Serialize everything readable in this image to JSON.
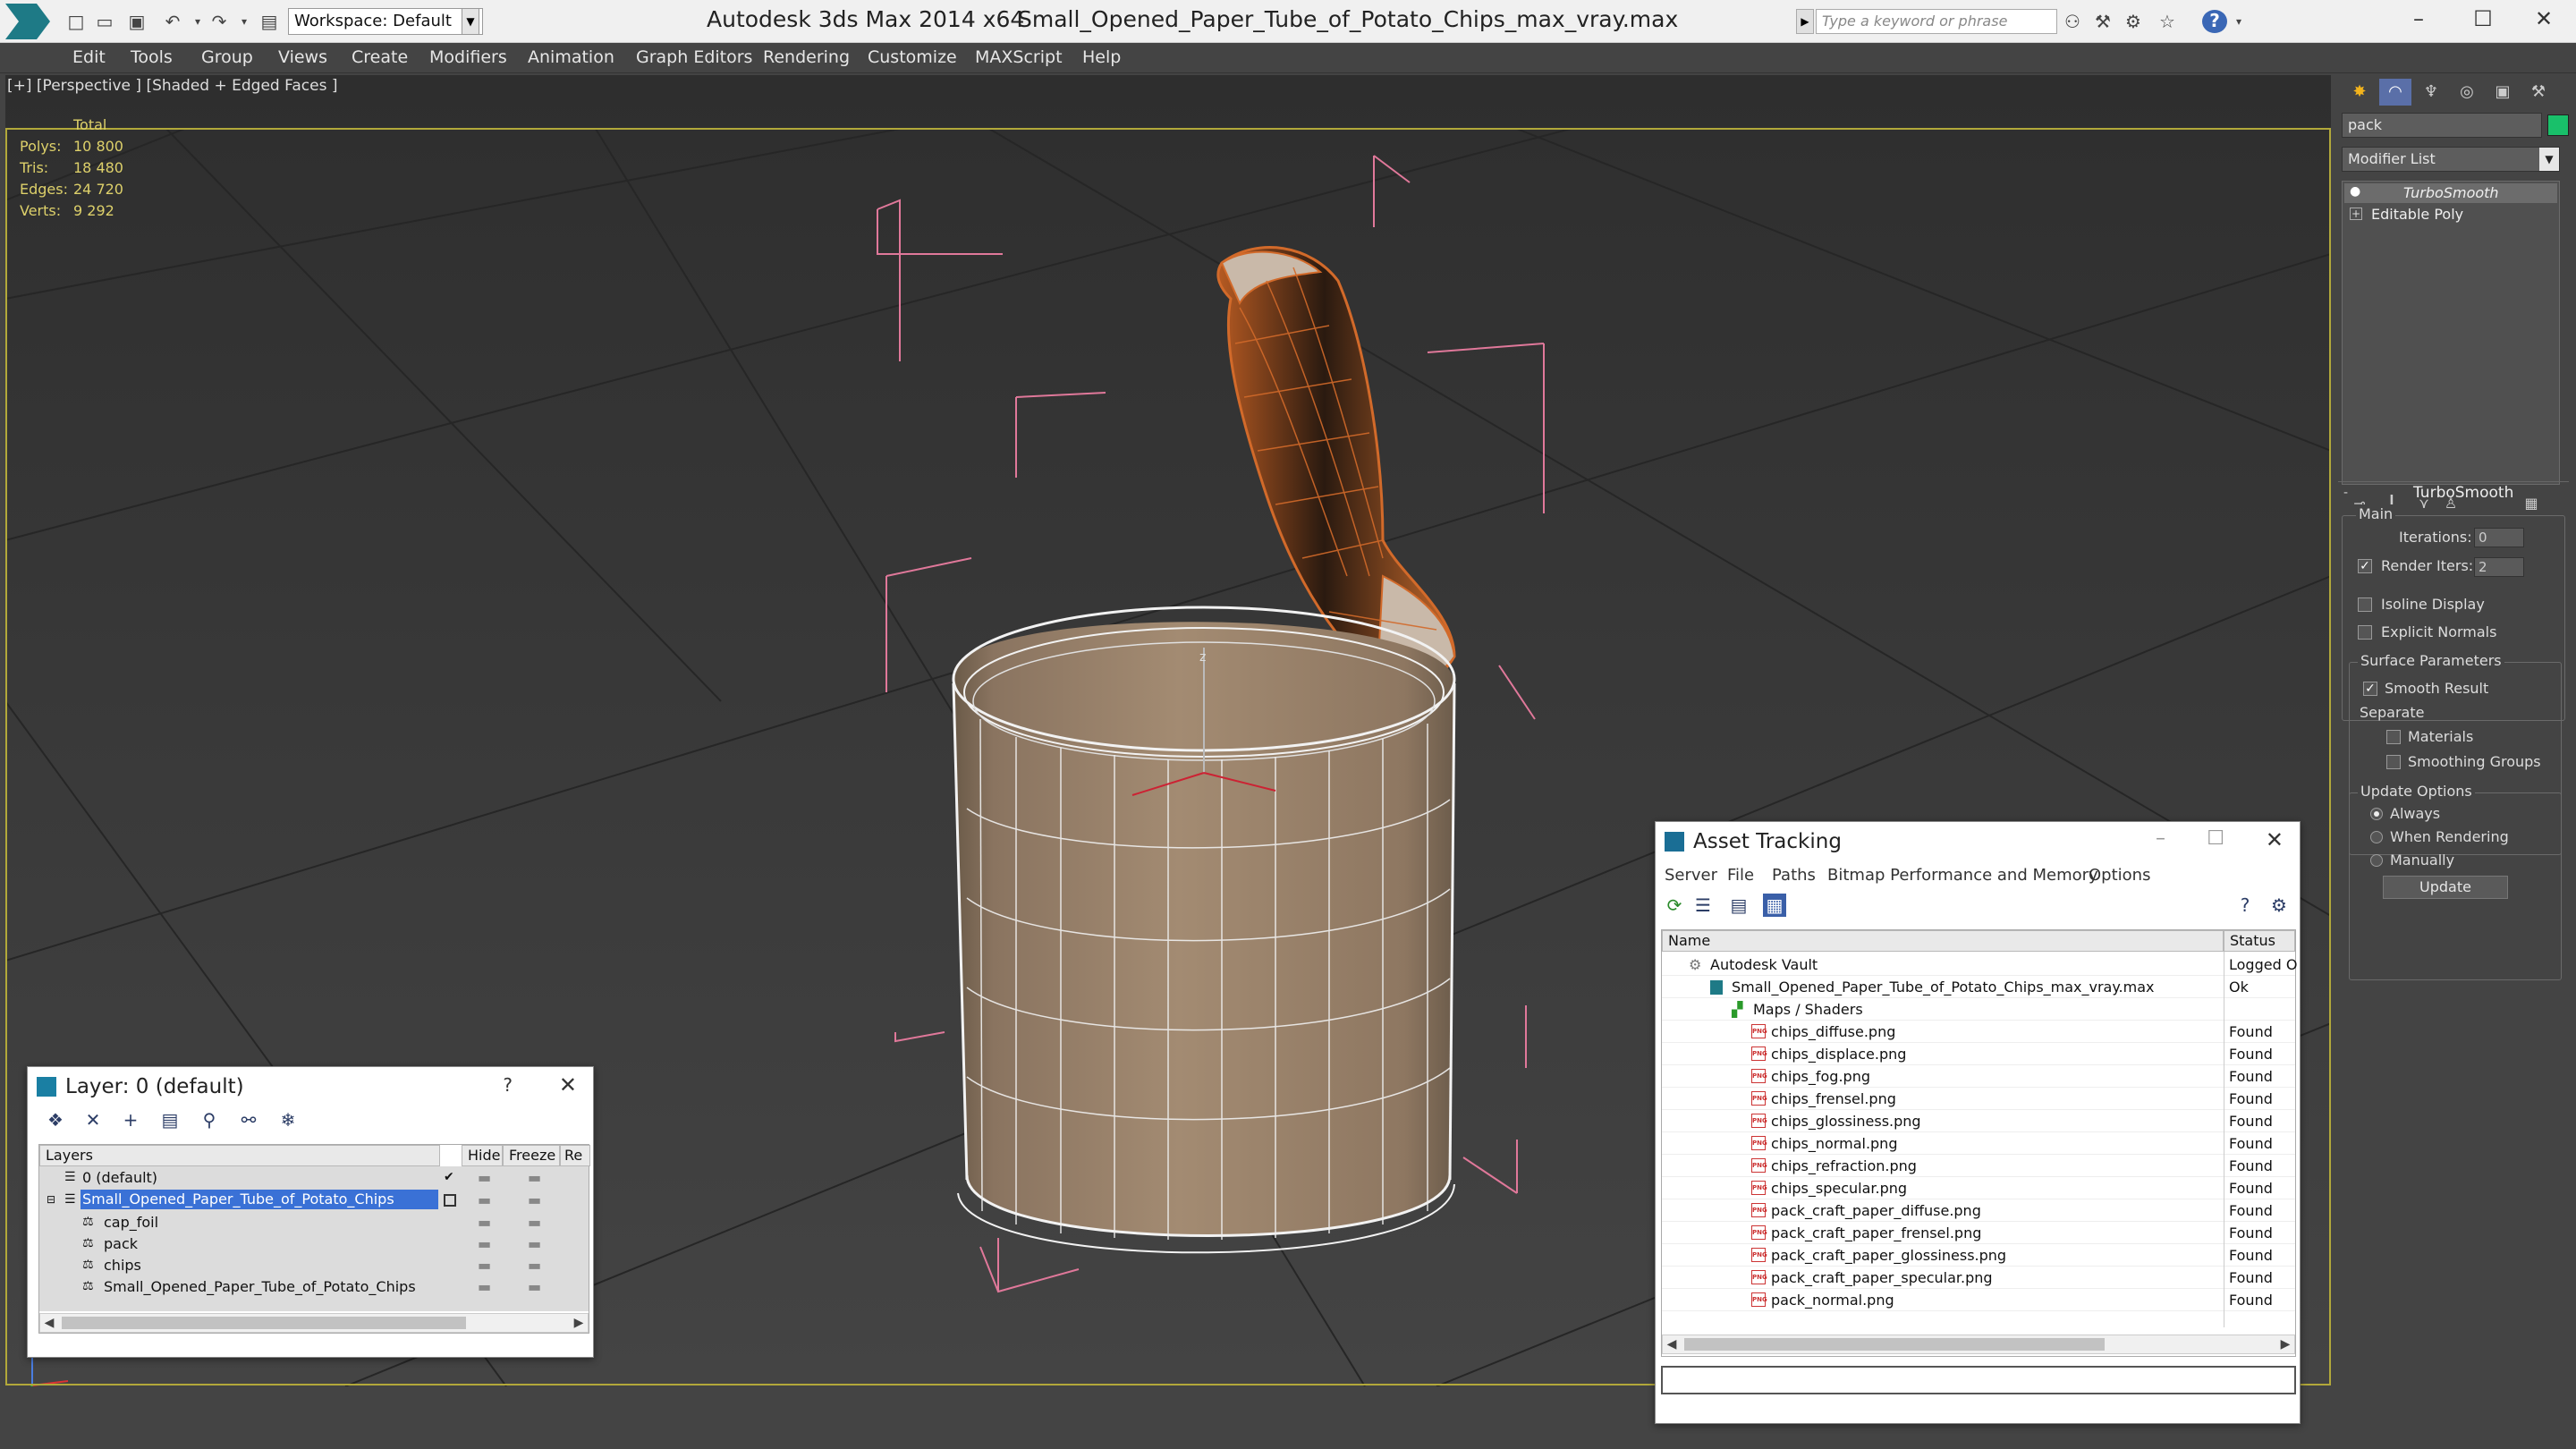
{
  "titlebar": {
    "app_title": "Autodesk 3ds Max  2014 x64",
    "file_title": "Small_Opened_Paper_Tube_of_Potato_Chips_max_vray.max",
    "workspace_label": "Workspace: Default",
    "search_placeholder": "Type a keyword or phrase",
    "minimize": "–",
    "maximize": "☐",
    "close": "✕"
  },
  "menu": [
    "Edit",
    "Tools",
    "Group",
    "Views",
    "Create",
    "Modifiers",
    "Animation",
    "Graph Editors",
    "Rendering",
    "Customize",
    "MAXScript",
    "Help"
  ],
  "viewport": {
    "label": "[+] [Perspective ] [Shaded + Edged Faces ]",
    "stats_header": "Total",
    "stats": [
      {
        "label": "Polys:",
        "value": "10 800"
      },
      {
        "label": "Tris:",
        "value": "18 480"
      },
      {
        "label": "Edges:",
        "value": "24 720"
      },
      {
        "label": "Verts:",
        "value": "9 292"
      }
    ],
    "gizmo_axis": "z"
  },
  "command_panel": {
    "object_name": "pack",
    "object_color": "#19c06a",
    "modifier_list": "Modifier List",
    "stack": [
      "TurboSmooth",
      "Editable Poly"
    ],
    "rollout_title": "TurboSmooth",
    "main_label": "Main",
    "iterations_label": "Iterations:",
    "iterations_value": "0",
    "render_iters_label": "Render Iters:",
    "render_iters_value": "2",
    "render_iters_checked": true,
    "isoline_label": "Isoline Display",
    "explicit_normals_label": "Explicit Normals",
    "surface_params_label": "Surface Parameters",
    "smooth_result_label": "Smooth Result",
    "smooth_result_checked": true,
    "separate_label": "Separate",
    "materials_label": "Materials",
    "smoothing_groups_label": "Smoothing Groups",
    "update_options_label": "Update Options",
    "always_label": "Always",
    "when_rendering_label": "When Rendering",
    "manually_label": "Manually",
    "update_options_selected": "Always",
    "update_button": "Update"
  },
  "layer_dialog": {
    "title": "Layer: 0 (default)",
    "help": "?",
    "close": "✕",
    "col_layers": "Layers",
    "col_hide": "Hide",
    "col_freeze": "Freeze",
    "col_render": "Re",
    "rows": [
      {
        "name": "0 (default)",
        "indent": 0,
        "type": "layer",
        "selected": false,
        "current": true
      },
      {
        "name": "Small_Opened_Paper_Tube_of_Potato_Chips",
        "indent": 0,
        "type": "layer",
        "selected": true,
        "current": false
      },
      {
        "name": "cap_foil",
        "indent": 1,
        "type": "object",
        "selected": false,
        "current": false
      },
      {
        "name": "pack",
        "indent": 1,
        "type": "object",
        "selected": false,
        "current": false
      },
      {
        "name": "chips",
        "indent": 1,
        "type": "object",
        "selected": false,
        "current": false
      },
      {
        "name": "Small_Opened_Paper_Tube_of_Potato_Chips",
        "indent": 1,
        "type": "object",
        "selected": false,
        "current": false
      }
    ]
  },
  "asset_dialog": {
    "title": "Asset Tracking",
    "menu": [
      "Server",
      "File",
      "Paths",
      "Bitmap Performance and Memory",
      "Options"
    ],
    "col_name": "Name",
    "col_status": "Status",
    "rows": [
      {
        "name": "Autodesk Vault",
        "status": "Logged O",
        "level": 0,
        "icon": "vault"
      },
      {
        "name": "Small_Opened_Paper_Tube_of_Potato_Chips_max_vray.max",
        "status": "Ok",
        "level": 1,
        "icon": "max"
      },
      {
        "name": "Maps / Shaders",
        "status": "",
        "level": 2,
        "icon": "maps"
      },
      {
        "name": "chips_diffuse.png",
        "status": "Found",
        "level": 3,
        "icon": "png"
      },
      {
        "name": "chips_displace.png",
        "status": "Found",
        "level": 3,
        "icon": "png"
      },
      {
        "name": "chips_fog.png",
        "status": "Found",
        "level": 3,
        "icon": "png"
      },
      {
        "name": "chips_frensel.png",
        "status": "Found",
        "level": 3,
        "icon": "png"
      },
      {
        "name": "chips_glossiness.png",
        "status": "Found",
        "level": 3,
        "icon": "png"
      },
      {
        "name": "chips_normal.png",
        "status": "Found",
        "level": 3,
        "icon": "png"
      },
      {
        "name": "chips_refraction.png",
        "status": "Found",
        "level": 3,
        "icon": "png"
      },
      {
        "name": "chips_specular.png",
        "status": "Found",
        "level": 3,
        "icon": "png"
      },
      {
        "name": "pack_craft_paper_diffuse.png",
        "status": "Found",
        "level": 3,
        "icon": "png"
      },
      {
        "name": "pack_craft_paper_frensel.png",
        "status": "Found",
        "level": 3,
        "icon": "png"
      },
      {
        "name": "pack_craft_paper_glossiness.png",
        "status": "Found",
        "level": 3,
        "icon": "png"
      },
      {
        "name": "pack_craft_paper_specular.png",
        "status": "Found",
        "level": 3,
        "icon": "png"
      },
      {
        "name": "pack_normal.png",
        "status": "Found",
        "level": 3,
        "icon": "png"
      }
    ]
  },
  "icons": {
    "png_badge": "PNG"
  }
}
